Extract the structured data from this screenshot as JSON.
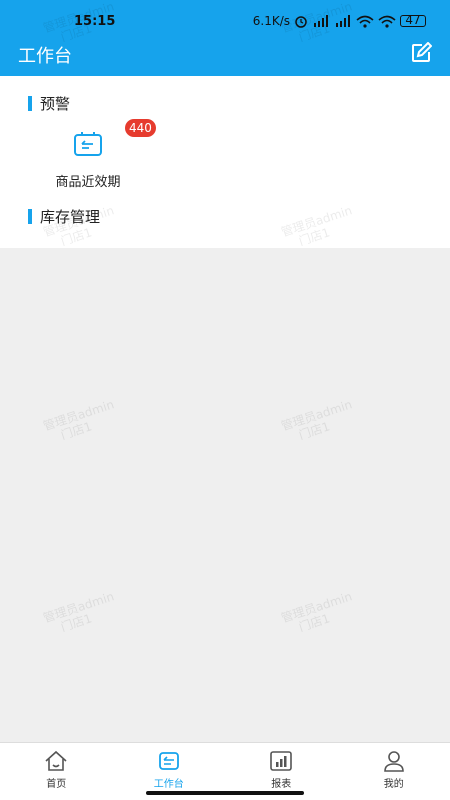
{
  "status_bar": {
    "time": "15:15",
    "network_speed": "6.1K/s",
    "battery": "47",
    "icons": [
      "alarm-icon",
      "hd-signal-icon",
      "hd-signal-icon",
      "wifi-icon",
      "wifi-icon",
      "battery-icon"
    ]
  },
  "header": {
    "title": "工作台",
    "edit_icon": "edit-icon"
  },
  "sections": {
    "warning": {
      "title": "预警"
    },
    "inventory": {
      "title": "库存管理"
    }
  },
  "warning_tiles": [
    {
      "label": "商品近效期",
      "badge": "440",
      "icon": "expiry-box-icon"
    }
  ],
  "watermark": {
    "line1": "管理员admin",
    "line2": "门店1"
  },
  "tabbar": {
    "items": [
      {
        "label": "首页",
        "icon": "home-icon",
        "active": false
      },
      {
        "label": "工作台",
        "icon": "workbench-icon",
        "active": true
      },
      {
        "label": "报表",
        "icon": "report-icon",
        "active": false
      },
      {
        "label": "我的",
        "icon": "profile-icon",
        "active": false
      }
    ]
  },
  "colors": {
    "primary": "#16a3ec",
    "badge": "#e63b2e",
    "background": "#efefef"
  }
}
